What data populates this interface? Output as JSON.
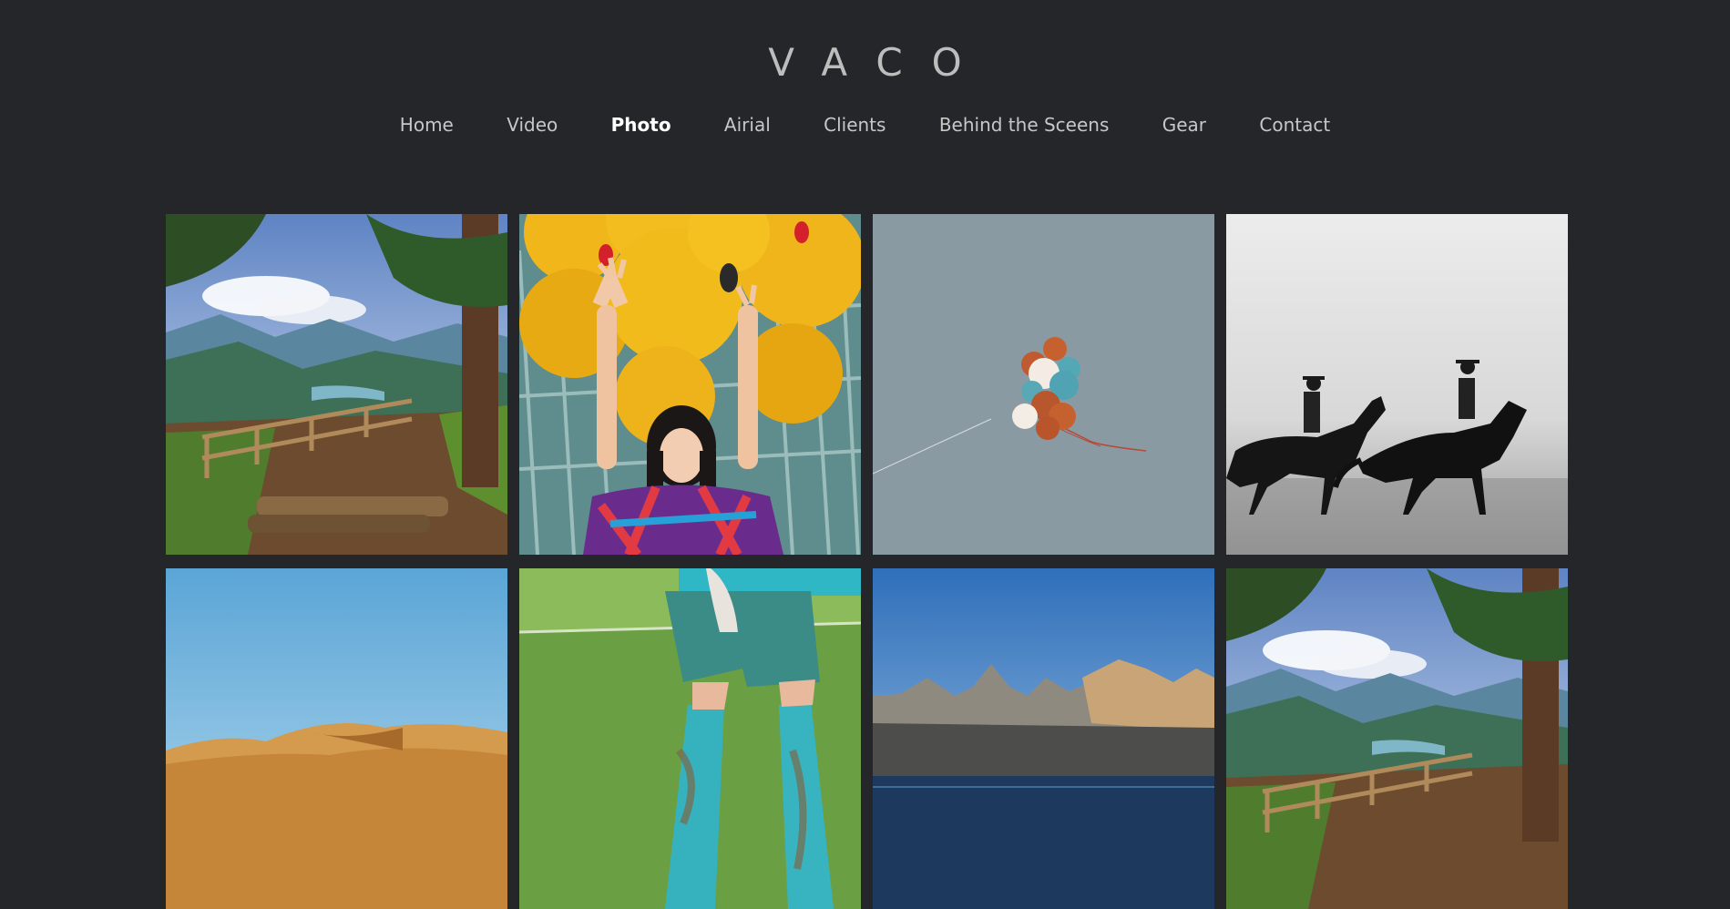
{
  "site": {
    "logo": "VACO"
  },
  "nav": {
    "items": [
      {
        "label": "Home"
      },
      {
        "label": "Video"
      },
      {
        "label": "Photo",
        "active": true
      },
      {
        "label": "Airial"
      },
      {
        "label": "Clients"
      },
      {
        "label": "Behind the Sceens"
      },
      {
        "label": "Gear"
      },
      {
        "label": "Contact"
      }
    ]
  },
  "gallery": {
    "photos": [
      {
        "subject": "forest-overlook"
      },
      {
        "subject": "woman-with-yellow-balloons"
      },
      {
        "subject": "balloons-in-sky"
      },
      {
        "subject": "horse-riders"
      },
      {
        "subject": "desert-dunes"
      },
      {
        "subject": "muddy-legs-on-grass"
      },
      {
        "subject": "mountain-lake"
      },
      {
        "subject": "forest-overlook"
      }
    ]
  },
  "colors": {
    "background": "#252629",
    "nav_text": "#c7c7c7",
    "nav_active": "#ffffff"
  }
}
